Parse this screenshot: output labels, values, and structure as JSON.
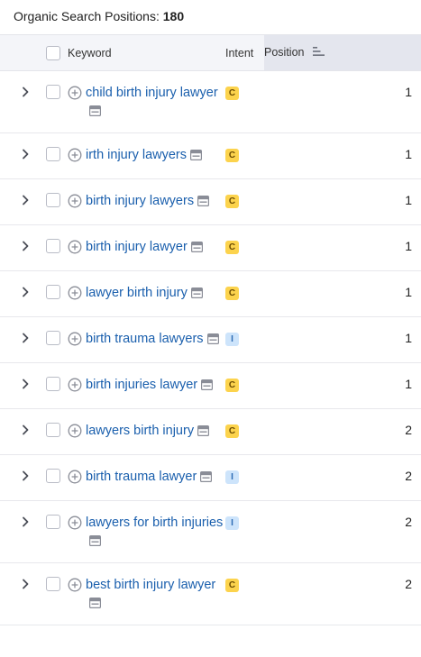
{
  "header": {
    "title": "Organic Search Positions:",
    "count": "180"
  },
  "columns": {
    "keyword": "Keyword",
    "intent": "Intent",
    "position": "Position"
  },
  "rows": [
    {
      "keyword": "child birth injury lawyer",
      "intent": "C",
      "position": "1"
    },
    {
      "keyword": "irth injury lawyers",
      "intent": "C",
      "position": "1"
    },
    {
      "keyword": "birth injury lawyers",
      "intent": "C",
      "position": "1"
    },
    {
      "keyword": "birth injury lawyer",
      "intent": "C",
      "position": "1"
    },
    {
      "keyword": "lawyer birth injury",
      "intent": "C",
      "position": "1"
    },
    {
      "keyword": "birth trauma lawyers",
      "intent": "I",
      "position": "1"
    },
    {
      "keyword": "birth injuries lawyer",
      "intent": "C",
      "position": "1"
    },
    {
      "keyword": "lawyers birth injury",
      "intent": "C",
      "position": "2"
    },
    {
      "keyword": "birth trauma lawyer",
      "intent": "I",
      "position": "2"
    },
    {
      "keyword": "lawyers for birth injuries",
      "intent": "I",
      "position": "2"
    },
    {
      "keyword": "best birth injury lawyer",
      "intent": "C",
      "position": "2"
    }
  ],
  "colors": {
    "link": "#1a5fad",
    "commercial_badge": "#fcd34d",
    "informational_badge": "#cde4fb",
    "header_bg": "#f4f5f9"
  },
  "icons": {
    "expand": "chevron-right-icon",
    "add": "plus-circle-icon",
    "serp": "serp-features-icon",
    "sort": "sort-descending-icon"
  }
}
